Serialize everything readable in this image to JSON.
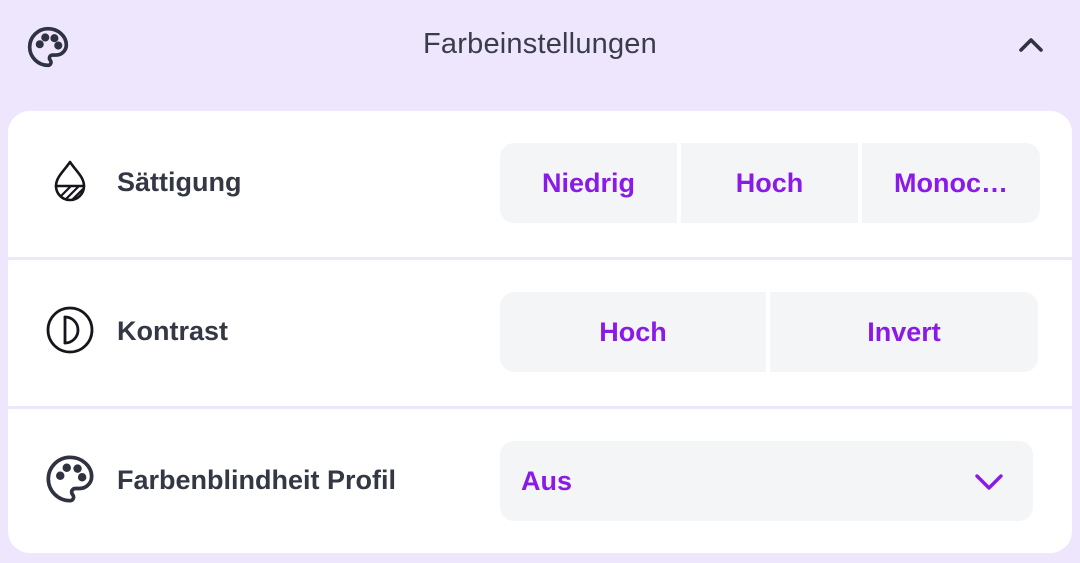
{
  "header": {
    "title": "Farbeinstellungen",
    "icon": "palette-icon",
    "collapse_icon": "chevron-up-icon"
  },
  "rows": [
    {
      "label": "Sättigung",
      "icon": "droplet-half-icon",
      "options": [
        "Niedrig",
        "Hoch",
        "Monoc…"
      ]
    },
    {
      "label": "Kontrast",
      "icon": "contrast-icon",
      "options": [
        "Hoch",
        "Invert"
      ]
    },
    {
      "label": "Farbenblindheit Profil",
      "icon": "palette-icon",
      "select": {
        "value": "Aus",
        "chevron_icon": "chevron-down-icon"
      }
    }
  ],
  "colors": {
    "accent": "#8a1be6",
    "panel_bg": "#ede6fd",
    "card_bg": "#ffffff",
    "button_bg": "#f4f5f7",
    "text": "#343844"
  }
}
